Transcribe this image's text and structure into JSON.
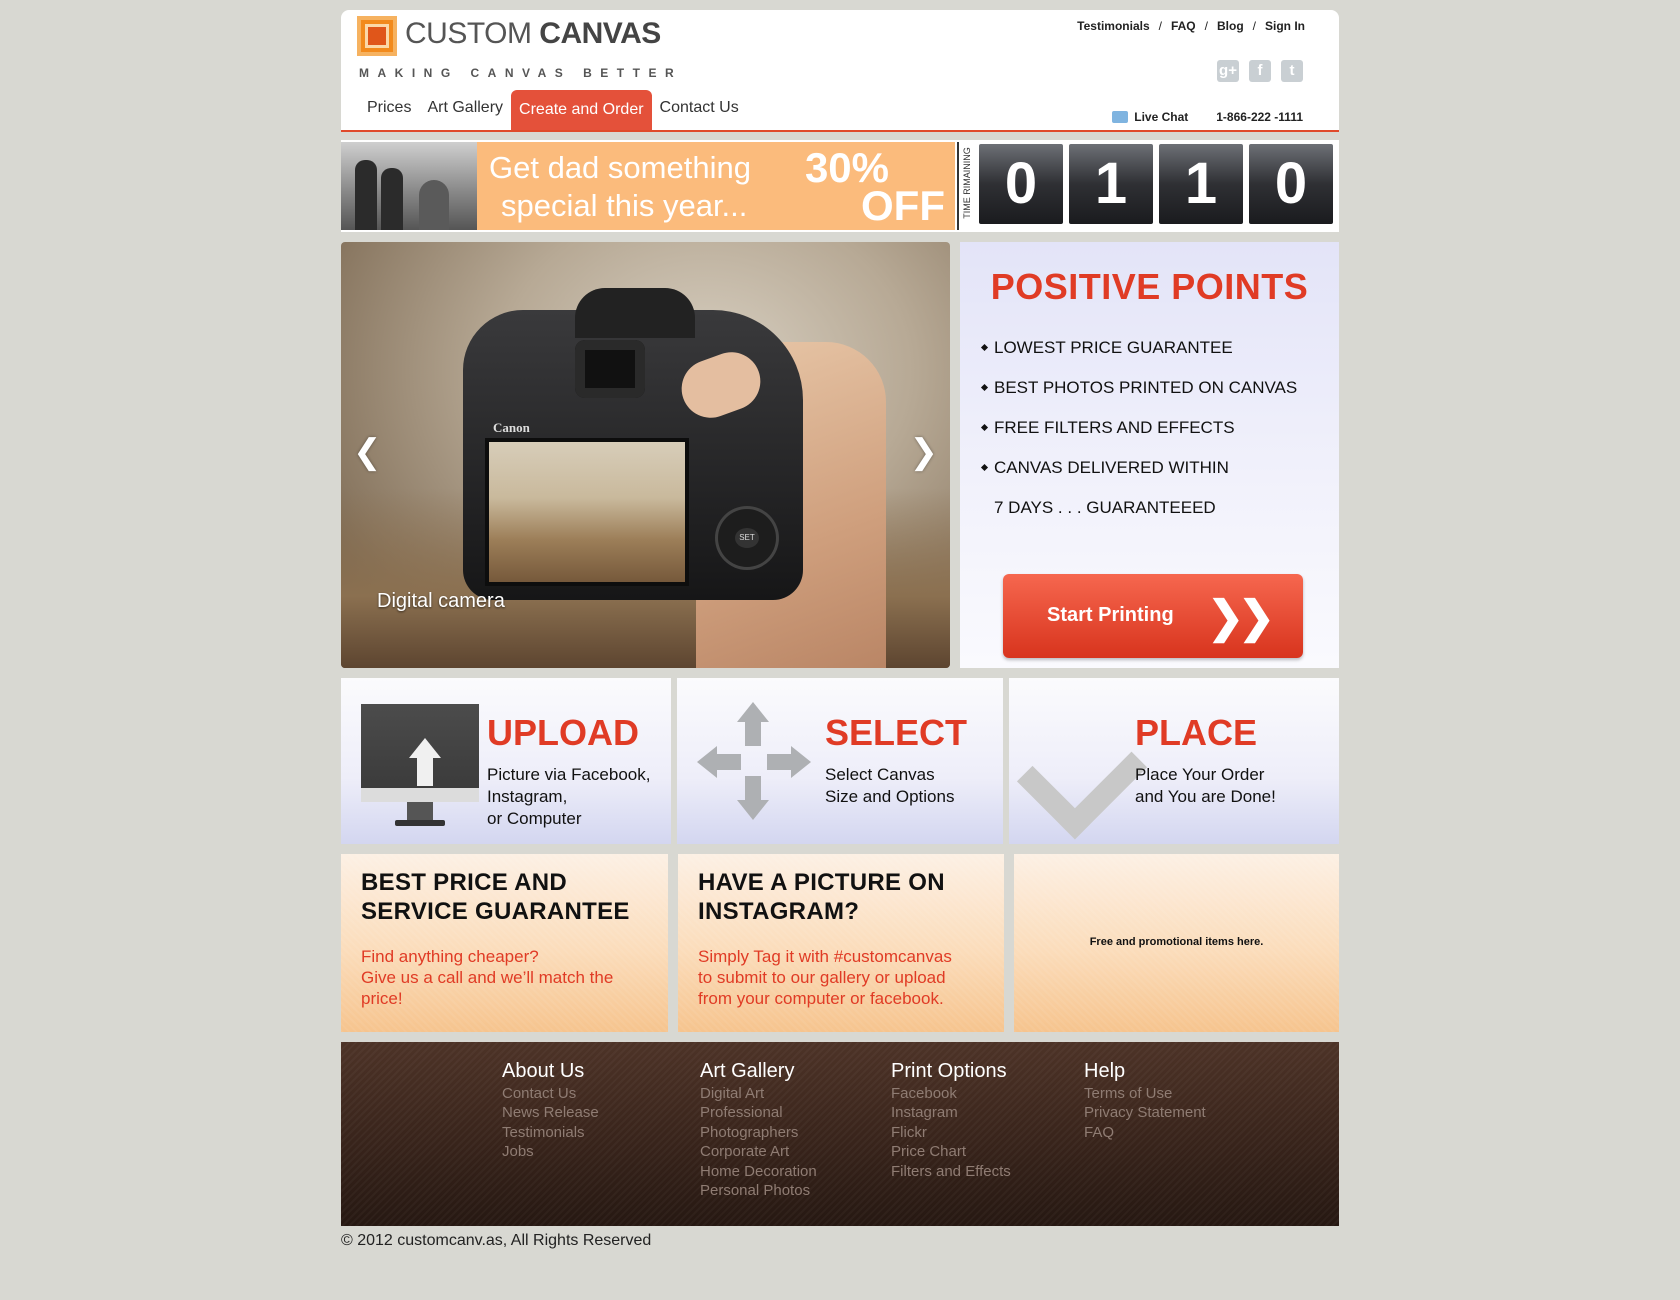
{
  "brand": {
    "name_light": "CUSTOM",
    "name_bold": "CANVAS",
    "tagline": "MAKING CANVAS BETTER"
  },
  "top_links": [
    "Testimonials",
    "FAQ",
    "Blog",
    "Sign In"
  ],
  "top_link_separator": "/",
  "social": [
    {
      "icon": "google-plus-icon",
      "glyph": "g+"
    },
    {
      "icon": "facebook-icon",
      "glyph": "f"
    },
    {
      "icon": "twitter-icon",
      "glyph": "t"
    }
  ],
  "nav": {
    "items": [
      "Prices",
      "Art Gallery",
      "Create and Order",
      "Contact Us"
    ],
    "active": "Create and Order"
  },
  "contact": {
    "live_chat": "Live Chat",
    "phone": "1-866-222 -1111"
  },
  "promo": {
    "line1": "Get dad something",
    "line2": "special this year...",
    "percent": "30%",
    "off": "OFF",
    "time_label": "TIME RIMAINING",
    "digits": [
      "0",
      "1",
      "1",
      "0"
    ]
  },
  "slider": {
    "caption": "Digital camera",
    "camera_brand": "Canon",
    "dial_label": "SET",
    "prev_glyph": "❮",
    "next_glyph": "❯"
  },
  "positive_points": {
    "title": "POSITIVE POINTS",
    "items": [
      "LOWEST PRICE GUARANTEE",
      "BEST PHOTOS PRINTED ON CANVAS",
      "FREE FILTERS AND EFFECTS",
      "CANVAS DELIVERED WITHIN"
    ],
    "continuation": "7 DAYS . . . GUARANTEEED",
    "button_label": "Start Printing",
    "button_glyph": "❯❯"
  },
  "steps": [
    {
      "title": "UPLOAD",
      "lines": [
        "Picture via Facebook,",
        "Instagram,",
        "or Computer"
      ]
    },
    {
      "title": "SELECT",
      "lines": [
        "Select Canvas",
        "Size and Options"
      ]
    },
    {
      "title": "PLACE",
      "lines": [
        "Place Your Order",
        "and You are Done!"
      ]
    }
  ],
  "infos": [
    {
      "title_lines": [
        "BEST PRICE AND",
        "SERVICE GUARANTEE"
      ],
      "text_lines": [
        "Find anything cheaper?",
        "Give us a call and we’ll match the",
        "price!"
      ]
    },
    {
      "title_lines": [
        "HAVE A PICTURE ON",
        "INSTAGRAM?"
      ],
      "text_lines": [
        "Simply Tag it with #customcanvas",
        "to submit to our gallery or upload",
        "from your computer or facebook."
      ]
    },
    {
      "promo_text": "Free and promotional items here."
    }
  ],
  "footer": {
    "columns": [
      {
        "title": "About Us",
        "links": [
          "Contact Us",
          "News Release",
          "Testimonials",
          "Jobs"
        ]
      },
      {
        "title": "Art Gallery",
        "links": [
          "Digital Art",
          "Professional",
          "Photographers",
          "Corporate Art",
          "Home Decoration",
          "Personal Photos"
        ]
      },
      {
        "title": "Print Options",
        "links": [
          "Facebook",
          "Instagram",
          "Flickr",
          "Price Chart",
          "Filters  and Effects"
        ]
      },
      {
        "title": "Help",
        "links": [
          "Terms of Use",
          "Privacy Statement",
          "FAQ"
        ]
      }
    ],
    "copyright": "© 2012 customcanv.as, All Rights Reserved"
  },
  "colors": {
    "accent_red": "#e03b25",
    "nav_active": "#e4513a",
    "promo_orange": "#fbbb7c",
    "footer_brown": "#3a251c",
    "page_background": "#d8d8d2"
  }
}
